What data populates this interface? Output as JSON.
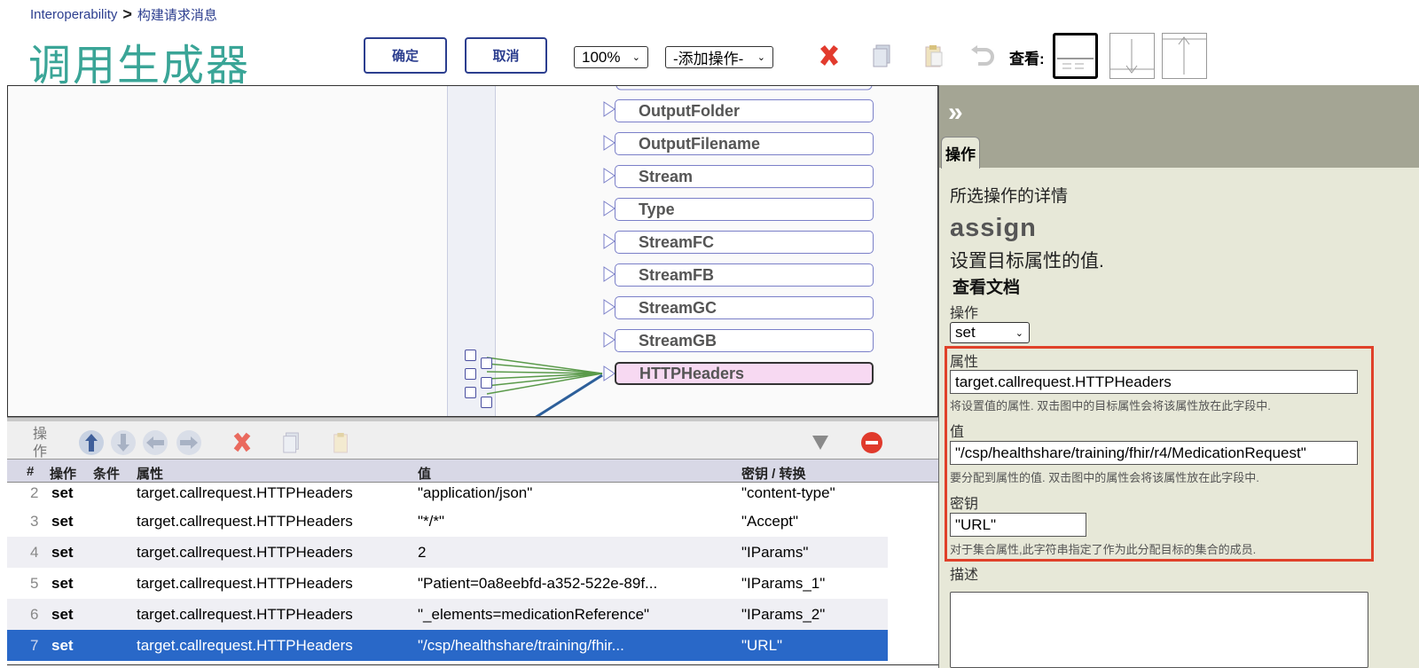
{
  "breadcrumb": {
    "root": "Interoperability",
    "separator": ">",
    "current": "构建请求消息"
  },
  "page_title": "调用生成器",
  "header": {
    "ok_label": "确定",
    "cancel_label": "取消",
    "zoom_value": "100%",
    "add_action_value": "-添加操作-",
    "view_label": "查看:"
  },
  "diagram": {
    "properties": [
      "OutputFolder",
      "OutputFilename",
      "Stream",
      "Type",
      "StreamFC",
      "StreamFB",
      "StreamGC",
      "StreamGB",
      "HTTPHeaders"
    ],
    "selected_property": "HTTPHeaders"
  },
  "bottom_toolbar": {
    "ops_label": "操作"
  },
  "table": {
    "headers": {
      "num": "#",
      "action": "操作",
      "condition": "条件",
      "property": "属性",
      "value": "值",
      "key": "密钥 / 转换"
    },
    "rows": [
      {
        "num": "2",
        "action": "set",
        "property": "target.callrequest.HTTPHeaders",
        "value": "\"application/json\"",
        "key": "\"content-type\""
      },
      {
        "num": "3",
        "action": "set",
        "property": "target.callrequest.HTTPHeaders",
        "value": "\"*/*\"",
        "key": "\"Accept\""
      },
      {
        "num": "4",
        "action": "set",
        "property": "target.callrequest.HTTPHeaders",
        "value": "2",
        "key": "\"IParams\""
      },
      {
        "num": "5",
        "action": "set",
        "property": "target.callrequest.HTTPHeaders",
        "value": "\"Patient=0a8eebfd-a352-522e-89f...",
        "key": "\"IParams_1\""
      },
      {
        "num": "6",
        "action": "set",
        "property": "target.callrequest.HTTPHeaders",
        "value": "\"_elements=medicationReference\"",
        "key": "\"IParams_2\""
      },
      {
        "num": "7",
        "action": "set",
        "property": "target.callrequest.HTTPHeaders",
        "value": "\"/csp/healthshare/training/fhir...",
        "key": "\"URL\""
      }
    ]
  },
  "right_panel": {
    "tab_label": "操作",
    "subtitle": "所选操作的详情",
    "action_name": "assign",
    "action_desc": "设置目标属性的值.",
    "doc_link": "查看文档",
    "action_label": "操作",
    "action_value": "set",
    "property_label": "属性",
    "property_value": "target.callrequest.HTTPHeaders",
    "property_hint": "将设置值的属性. 双击图中的目标属性会将该属性放在此字段中.",
    "value_label": "值",
    "value_value": "\"/csp/healthshare/training/fhir/r4/MedicationRequest\"",
    "value_hint": "要分配到属性的值. 双击图中的属性会将该属性放在此字段中.",
    "key_label": "密钥",
    "key_value": "\"URL\"",
    "key_hint": "对于集合属性,此字符串指定了作为此分配目标的集合的成员.",
    "description_label": "描述",
    "description_value": ""
  },
  "colors": {
    "accent": "#3aa597",
    "brand": "#2c3e8f",
    "selection": "#2968c8",
    "highlight": "#e0412a"
  }
}
